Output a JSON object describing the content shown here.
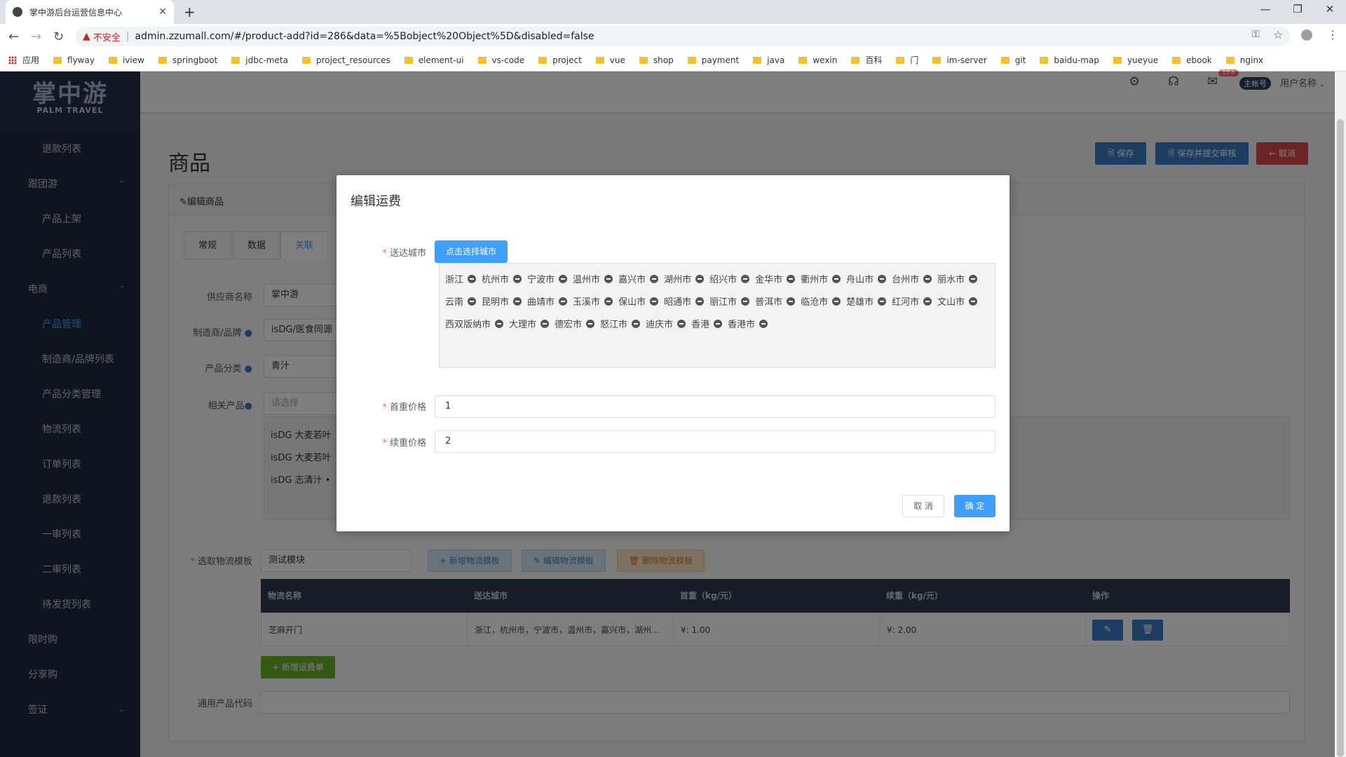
{
  "browser": {
    "tab_title": "掌中游后台运营信息中心",
    "insecure_label": "不安全",
    "url": "admin.zzumall.com/#/product-add?id=286&data=%5Bobject%20Object%5D&disabled=false",
    "bookmarks": [
      "应用",
      "flyway",
      "iview",
      "springboot",
      "jdbc-meta",
      "project_resources",
      "element-ui",
      "vs-code",
      "project",
      "vue",
      "shop",
      "payment",
      "java",
      "wexin",
      "百科",
      "门",
      "im-server",
      "git",
      "baidu-map",
      "yueyue",
      "ebook",
      "nginx"
    ]
  },
  "logo": {
    "cn": "掌中游",
    "en": "PALM TRAVEL"
  },
  "sidebar": {
    "items": [
      {
        "label": "退款列表",
        "type": "sub"
      },
      {
        "label": "跟团游",
        "type": "grp",
        "arrow": "⌃"
      },
      {
        "label": "产品上架",
        "type": "sub"
      },
      {
        "label": "产品列表",
        "type": "sub"
      },
      {
        "label": "电商",
        "type": "grp",
        "arrow": "⌃"
      },
      {
        "label": "产品管理",
        "type": "sub",
        "active": true
      },
      {
        "label": "制造商/品牌列表",
        "type": "sub"
      },
      {
        "label": "产品分类管理",
        "type": "sub"
      },
      {
        "label": "物流列表",
        "type": "sub"
      },
      {
        "label": "订单列表",
        "type": "sub"
      },
      {
        "label": "退款列表",
        "type": "sub"
      },
      {
        "label": "一审列表",
        "type": "sub"
      },
      {
        "label": "二审列表",
        "type": "sub"
      },
      {
        "label": "待发货列表",
        "type": "sub"
      },
      {
        "label": "限时购",
        "type": "grp"
      },
      {
        "label": "分享购",
        "type": "grp"
      },
      {
        "label": "签证",
        "type": "grp",
        "arrow": "⌄"
      }
    ]
  },
  "header": {
    "mail_badge": "10+",
    "account_tag": "主帐号",
    "username": "用户名称"
  },
  "page": {
    "title": "商品",
    "save": "保存",
    "save_submit": "保存并提交审核",
    "cancel": "取消",
    "panel_title": "编辑商品",
    "tabs": [
      "常规",
      "数据",
      "关联"
    ],
    "supplier_label": "供应商名称",
    "supplier_value": "掌中游",
    "brand_label": "制造商/品牌",
    "brand_value": "isDG/医食同源",
    "category_label": "产品分类",
    "category_value": "青汁",
    "related_label": "相关产品",
    "related_placeholder": "请选择",
    "related_list": [
      "isDG 大麦若叶",
      "isDG 大麦若叶",
      "isDG 志清汁 •"
    ],
    "logistics_label": "选取物流模板",
    "logistics_value": "测试模块",
    "add_logistics": "新增物流模板",
    "edit_logistics": "编辑物流模板",
    "delete_logistics": "删除物流模板",
    "table_headers": [
      "物流名称",
      "送达城市",
      "首重（kg/元）",
      "续重（kg/元）",
      "操作"
    ],
    "table_row": [
      "芝麻开门",
      "浙江，杭州市，宁波市，温州市，嘉兴市，湖州...",
      "¥: 1.00",
      "¥: 2.00"
    ],
    "add_shipping": "新增运费单",
    "product_code_label": "通用产品代码"
  },
  "modal": {
    "title": "编辑运费",
    "city_label": "送达城市",
    "pick_city": "点击选择城市",
    "cities": [
      "浙江",
      "杭州市",
      "宁波市",
      "温州市",
      "嘉兴市",
      "湖州市",
      "绍兴市",
      "金华市",
      "衢州市",
      "舟山市",
      "台州市",
      "丽水市",
      "云南",
      "昆明市",
      "曲靖市",
      "玉溪市",
      "保山市",
      "昭通市",
      "丽江市",
      "普洱市",
      "临沧市",
      "楚雄市",
      "红河市",
      "文山市",
      "西双版纳市",
      "大理市",
      "德宏市",
      "怒江市",
      "迪庆市",
      "香港",
      "香港市"
    ],
    "first_weight_label": "首重价格",
    "first_weight_value": "1",
    "extra_weight_label": "续重价格",
    "extra_weight_value": "2",
    "cancel": "取 消",
    "ok": "确 定"
  },
  "colors": {
    "primary": "#409eff",
    "sidebar_bg": "#1f2a3d",
    "danger": "#e04b4b",
    "success": "#67b226"
  }
}
